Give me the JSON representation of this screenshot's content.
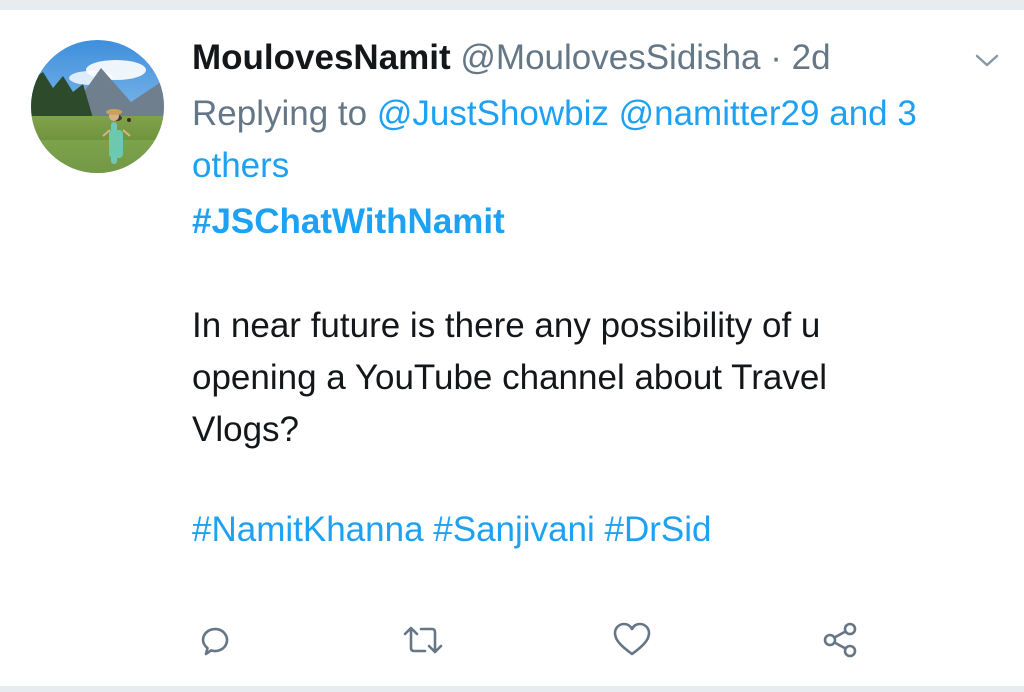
{
  "tweet": {
    "display_name": "MoulovesNamit",
    "handle": "@MoulovesSidisha",
    "separator": "·",
    "timestamp": "2d",
    "replying_prefix": "Replying to",
    "reply_mentions": [
      "@JustShowbiz",
      "@namitter29"
    ],
    "reply_and": "and",
    "reply_others": "3 others",
    "hashtag_heading": "#JSChatWithNamit",
    "body": "In near future is there any possibility of u opening a YouTube channel about Travel Vlogs?",
    "hashtags": [
      "#NamitKhanna",
      "#Sanjivani",
      "#DrSid"
    ]
  },
  "icons": {
    "menu": "chevron-down-icon",
    "reply": "reply-icon",
    "retweet": "retweet-icon",
    "like": "heart-icon",
    "share": "share-icon"
  },
  "colors": {
    "link": "#1da1f2",
    "secondary_text": "#657786",
    "primary_text": "#14171a",
    "divider": "#e6ecf0"
  }
}
